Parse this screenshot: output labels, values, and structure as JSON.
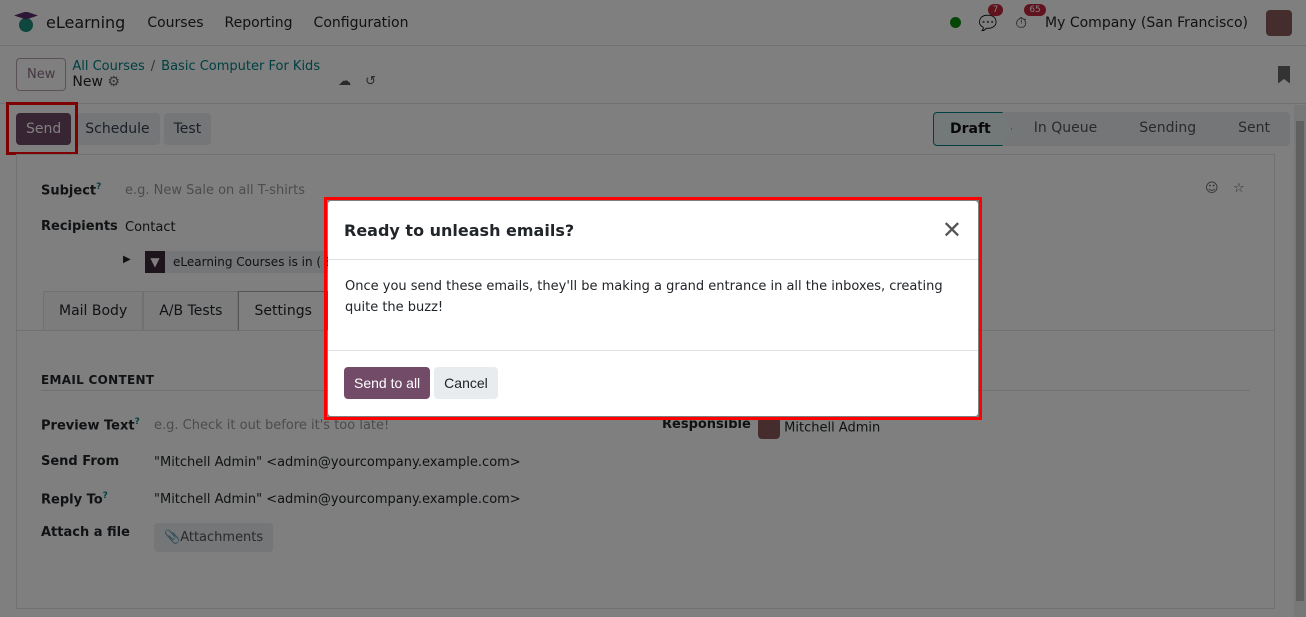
{
  "topbar": {
    "app": "eLearning",
    "menu": [
      "Courses",
      "Reporting",
      "Configuration"
    ],
    "messages_count": "7",
    "activities_count": "65",
    "company": "My Company (San Francisco)"
  },
  "control": {
    "new_button": "New",
    "breadcrumb": [
      "All Courses",
      "Basic Computer For Kids"
    ],
    "record": "New"
  },
  "actions": {
    "send": "Send",
    "schedule": "Schedule",
    "test": "Test"
  },
  "status": {
    "stages": [
      "Draft",
      "In Queue",
      "Sending",
      "Sent"
    ],
    "current": "Draft"
  },
  "form": {
    "subject_label": "Subject",
    "subject_placeholder": "e.g. New Sale on all T-shirts",
    "recipients_label": "Recipients",
    "recipients_value": "Contact",
    "filter": "eLearning Courses is in ( B",
    "tabs": [
      "Mail Body",
      "A/B Tests",
      "Settings"
    ],
    "active_tab": "Settings",
    "section": "EMAIL CONTENT",
    "preview_label": "Preview Text",
    "preview_placeholder": "e.g. Check it out before it's too late!",
    "send_from_label": "Send From",
    "send_from": "\"Mitchell Admin\" <admin@yourcompany.example.com>",
    "reply_to_label": "Reply To",
    "reply_to": "\"Mitchell Admin\" <admin@yourcompany.example.com>",
    "attach_label": "Attach a file",
    "attachments": "Attachments",
    "responsible_label": "Responsible",
    "responsible": "Mitchell Admin"
  },
  "dialog": {
    "title": "Ready to unleash emails?",
    "body": "Once you send these emails, they'll be making a grand entrance in all the inboxes, creating quite the buzz!",
    "confirm": "Send to all",
    "cancel": "Cancel"
  },
  "colors": {
    "primary": "#714b67",
    "link": "#017e84",
    "highlight": "#ff0000"
  }
}
